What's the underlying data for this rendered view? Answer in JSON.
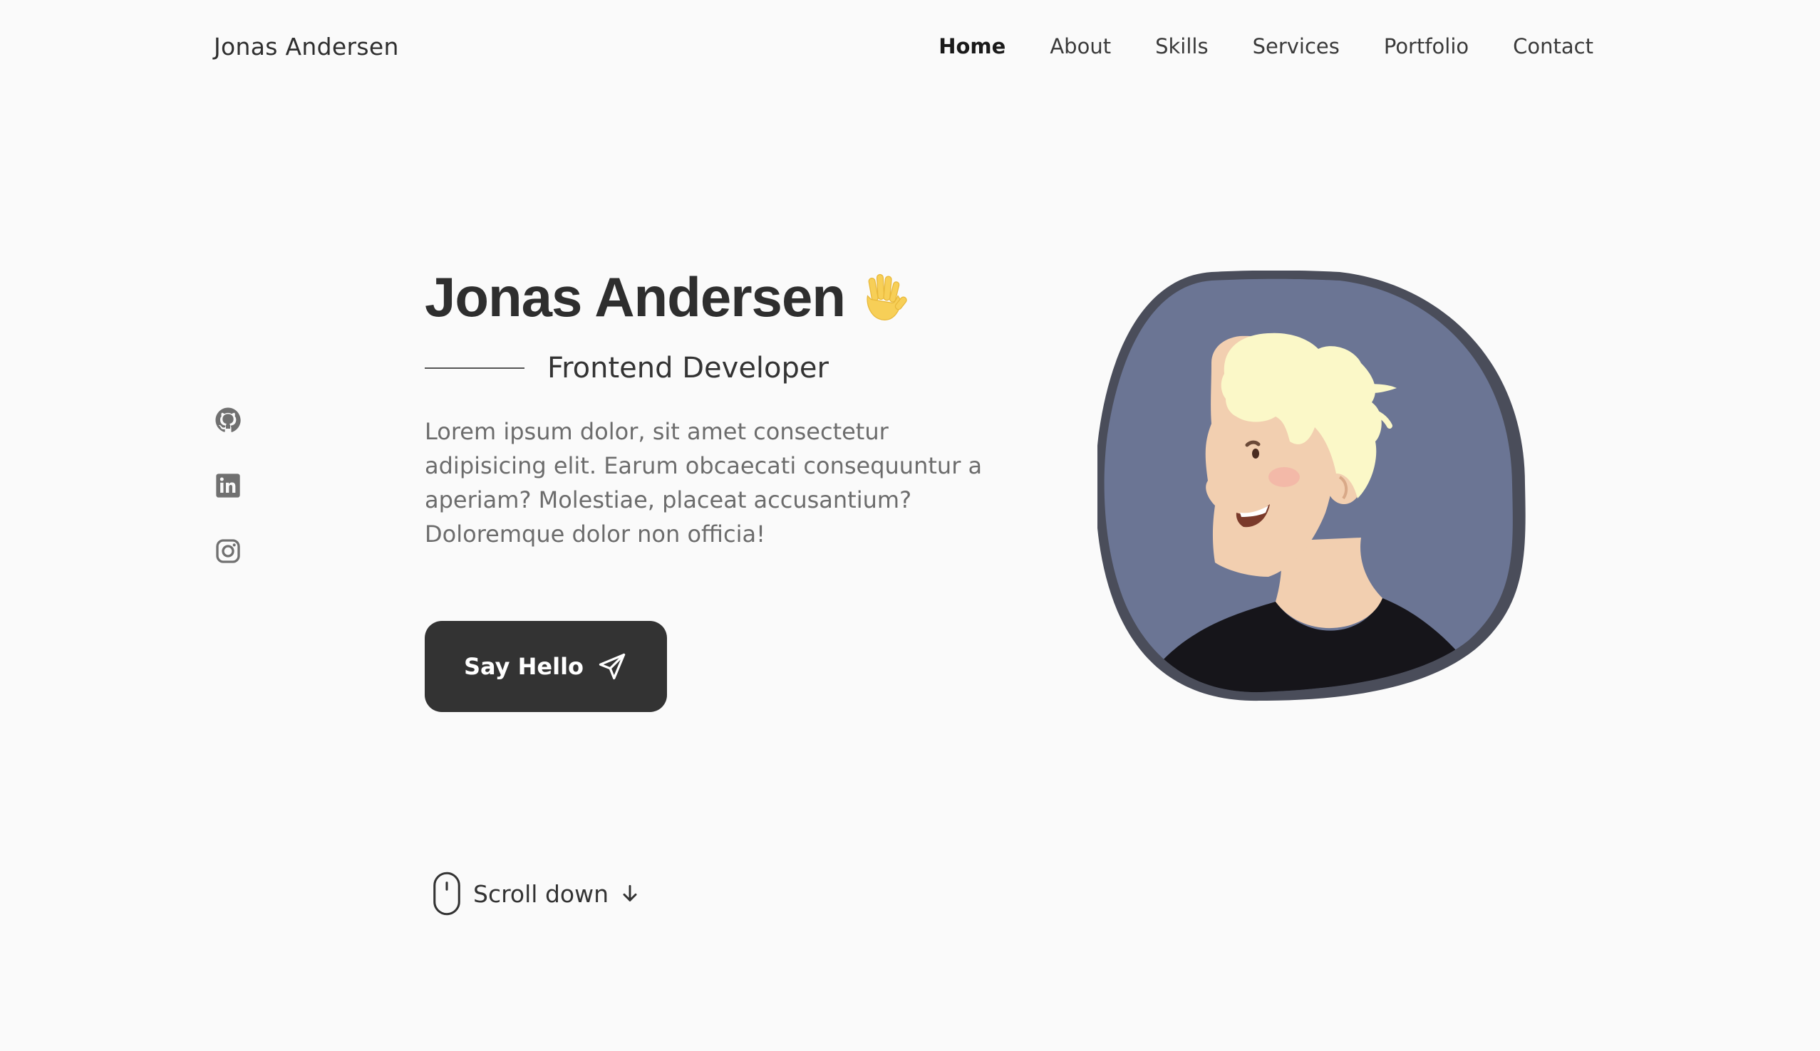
{
  "header": {
    "logo": "Jonas Andersen",
    "nav": [
      {
        "label": "Home",
        "active": true
      },
      {
        "label": "About"
      },
      {
        "label": "Skills"
      },
      {
        "label": "Services"
      },
      {
        "label": "Portfolio"
      },
      {
        "label": "Contact"
      }
    ]
  },
  "social": [
    {
      "icon": "github-icon"
    },
    {
      "icon": "linkedin-icon"
    },
    {
      "icon": "instagram-icon"
    }
  ],
  "hero": {
    "name": "Jonas Andersen",
    "wave_icon": "waving-hand-icon",
    "role": "Frontend Developer",
    "description": "Lorem ipsum dolor, sit amet consectetur adipisicing elit. Earum obcaecati consequuntur a aperiam? Molestiae, placeat accusantium? Doloremque dolor non officia!",
    "cta_label": "Say Hello",
    "cta_icon": "send-icon"
  },
  "scroll": {
    "label": "Scroll down",
    "mouse_icon": "mouse-icon",
    "arrow_icon": "arrow-down-icon"
  },
  "colors": {
    "background": "#fafafa",
    "text_dark": "#333333",
    "text_muted": "#6c6c6c",
    "button": "#333333",
    "avatar_bg": "#6b7594",
    "avatar_border": "#4a4d5a",
    "hair": "#fbf8c8",
    "skin": "#f2cfb0",
    "shirt": "#16151a"
  }
}
